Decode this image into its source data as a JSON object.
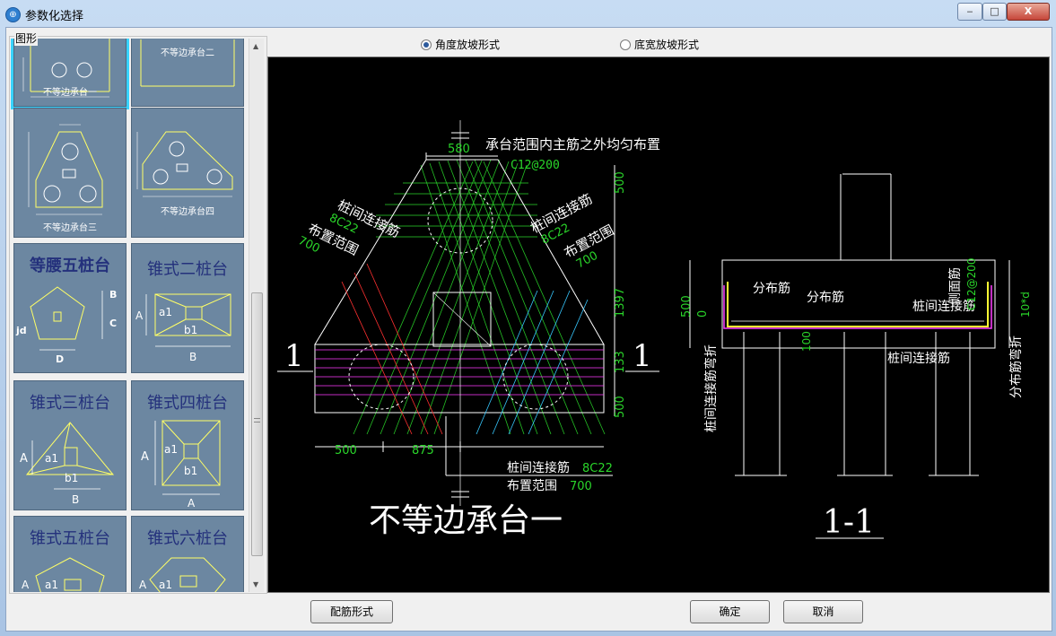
{
  "window": {
    "title": "参数化选择",
    "icon": "app-icon"
  },
  "window_controls": {
    "minimize": "‒",
    "maximize": "□",
    "close": "X"
  },
  "left_panel": {
    "group_label": "图形",
    "thumbnails": [
      {
        "label": "不等边承台一",
        "selected": true
      },
      {
        "label": "不等边承台二",
        "selected": false
      },
      {
        "label": "不等边承台三",
        "selected": false
      },
      {
        "label": "不等边承台四",
        "selected": false
      },
      {
        "label": "等腰五桩台",
        "selected": false
      },
      {
        "label": "锥式二桩台",
        "selected": false
      },
      {
        "label": "锥式三桩台",
        "selected": false
      },
      {
        "label": "锥式四桩台",
        "selected": false
      },
      {
        "label": "锥式五桩台",
        "selected": false
      },
      {
        "label": "锥式六桩台",
        "selected": false
      }
    ]
  },
  "options": {
    "radio1": {
      "label": "角度放坡形式",
      "checked": true
    },
    "radio2": {
      "label": "底宽放坡形式",
      "checked": false
    }
  },
  "drawing": {
    "title": "不等边承台一",
    "section_title": "1-1",
    "section_mark": "1",
    "top_note": "承台范围内主筋之外均匀布置",
    "top_rebar": "C12@200",
    "left_label1": "桩间连接筋",
    "left_label1_spec": "8C22",
    "left_label2": "布置范围",
    "left_label2_spec": "700",
    "right_label1": "桩间连接筋",
    "right_label1_spec": "8C22",
    "right_label2": "布置范围",
    "right_label2_spec": "700",
    "bottom_label1": "桩间连接筋",
    "bottom_label1_spec": "8C22",
    "bottom_label2": "布置范围",
    "bottom_label2_spec": "700",
    "dims": {
      "top": "580",
      "bl": "500",
      "bm": "875",
      "r1": "500",
      "r2": "1397",
      "r3": "133",
      "r4": "500"
    },
    "section": {
      "dist1": "分布筋",
      "dist2": "分布筋",
      "side": "侧面筋",
      "side_spec": "C12@200",
      "link1": "桩间连接筋",
      "link2": "桩间连接筋",
      "hook1": "桩间连接筋弯折",
      "hook2": "分布筋弯折",
      "hook_spec": "10*d",
      "d500": "500",
      "d0": "0",
      "d100": "100"
    }
  },
  "buttons": {
    "rebar_form": "配筋形式",
    "ok": "确定",
    "cancel": "取消"
  }
}
